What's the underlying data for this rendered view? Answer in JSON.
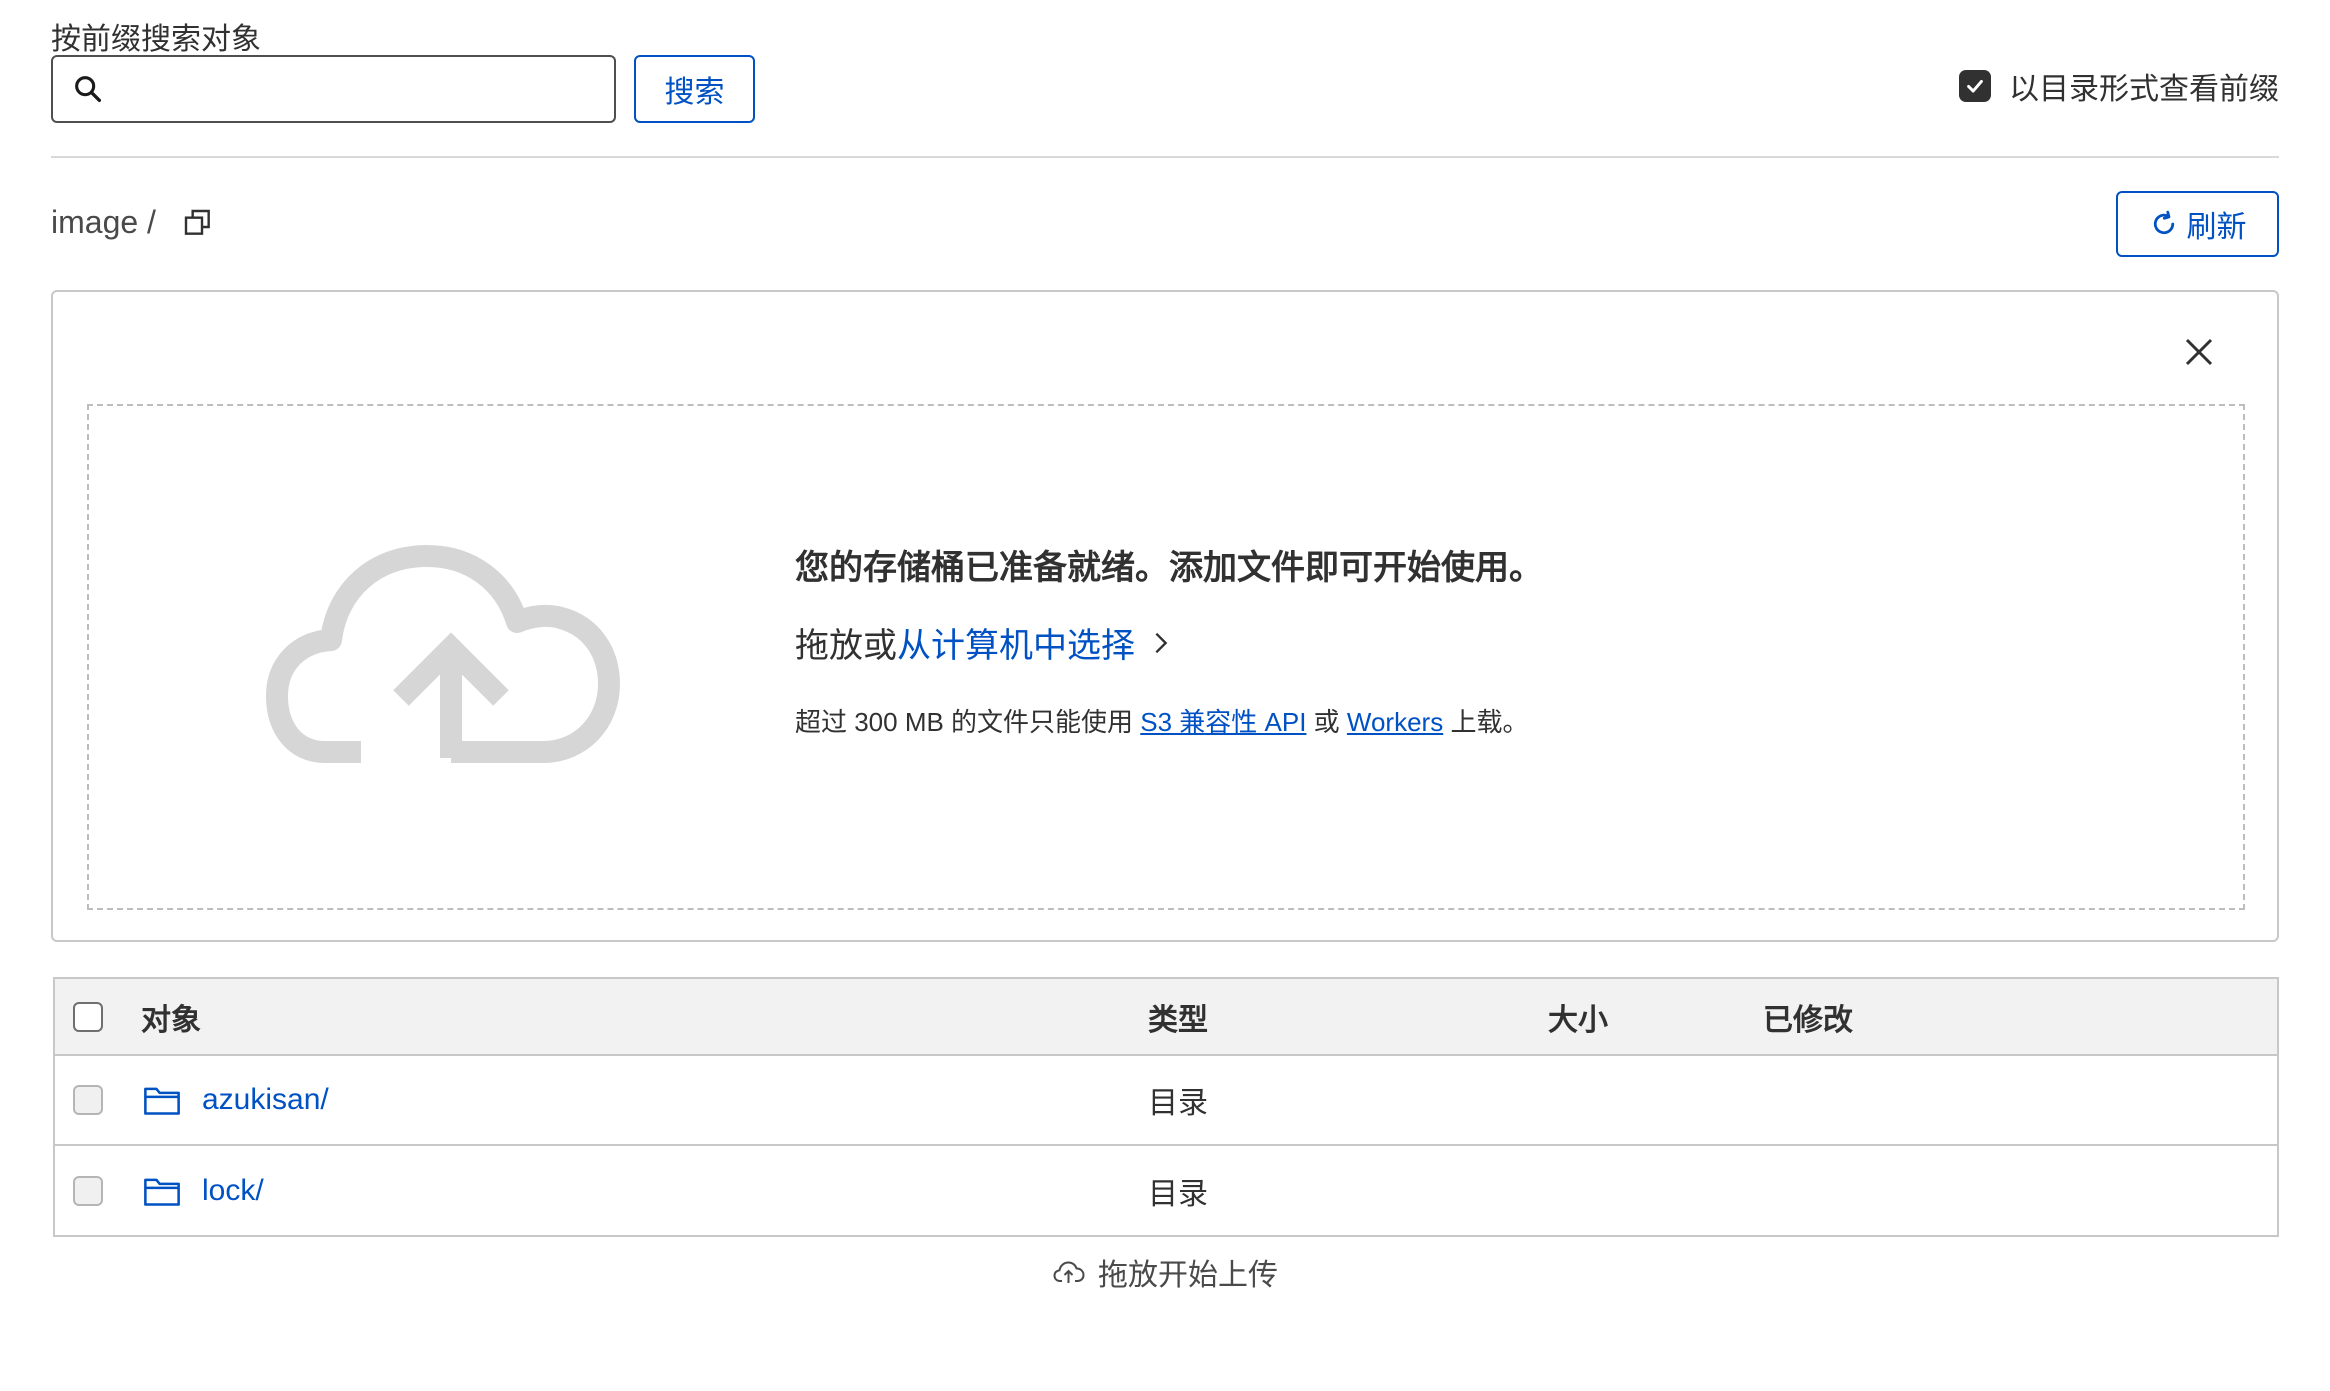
{
  "search": {
    "label": "按前缀搜索对象",
    "value": "",
    "placeholder": "",
    "button_label": "搜索"
  },
  "directory_view": {
    "label": "以目录形式查看前缀",
    "checked": true
  },
  "breadcrumb": {
    "path": "image /"
  },
  "refresh_label": "刷新",
  "upload": {
    "ready_message": "您的存储桶已准备就绪。添加文件即可开始使用。",
    "drag_prefix": "拖放或",
    "select_link": "从计算机中选择",
    "note_prefix": "超过 300 MB 的文件只能使用 ",
    "note_link1": "S3 兼容性 API",
    "note_mid": " 或 ",
    "note_link2": "Workers",
    "note_suffix": " 上载。"
  },
  "table": {
    "headers": {
      "object": "对象",
      "type": "类型",
      "size": "大小",
      "modified": "已修改"
    },
    "rows": [
      {
        "name": "azukisan/",
        "type": "目录",
        "size": "",
        "modified": ""
      },
      {
        "name": "lock/",
        "type": "目录",
        "size": "",
        "modified": ""
      }
    ]
  },
  "drop_hint": "拖放开始上传",
  "colors": {
    "accent": "#0051c3",
    "text": "#313131",
    "border": "#c8c8c8",
    "header_bg": "#f2f2f2",
    "cloud_gray": "#d6d6d6"
  }
}
